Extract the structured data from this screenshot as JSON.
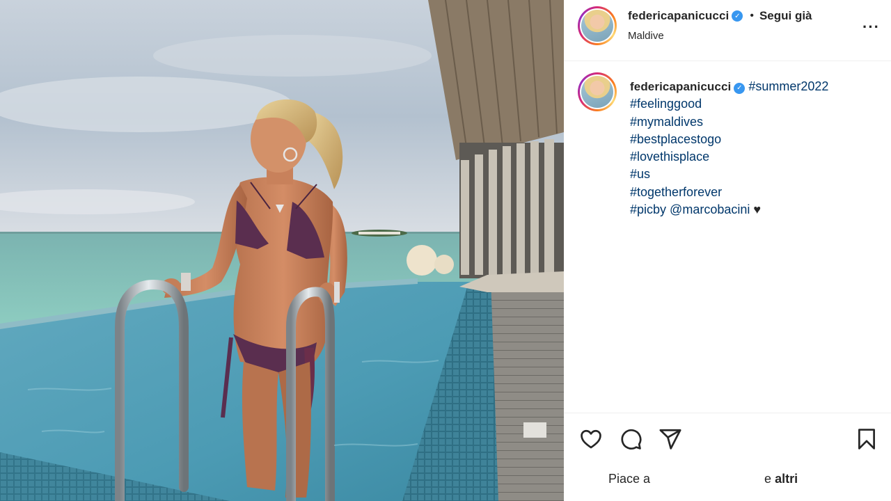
{
  "post": {
    "username": "federicapanicucci",
    "verified_mark": "✓",
    "separator": "•",
    "follow_label": "Segui già",
    "location": "Maldive",
    "more_label": "···"
  },
  "caption": {
    "username": "federicapanicucci",
    "first_tag": "#summer2022",
    "tags": [
      "#feelinggood",
      "#mymaldives",
      "#bestplacestogo",
      "#lovethisplace",
      "#us",
      "#togetherforever"
    ],
    "last_line_tag": "#picby",
    "mention": "@marcobacini",
    "heart": "♥"
  },
  "actions": {
    "icons": [
      "heart-icon",
      "comment-icon",
      "share-icon",
      "bookmark-icon"
    ]
  },
  "likes": {
    "prefix": "Piace a",
    "suffix": "e",
    "others": "altri"
  },
  "colors": {
    "link": "#00376b",
    "verified": "#3897f0",
    "text": "#262626"
  }
}
